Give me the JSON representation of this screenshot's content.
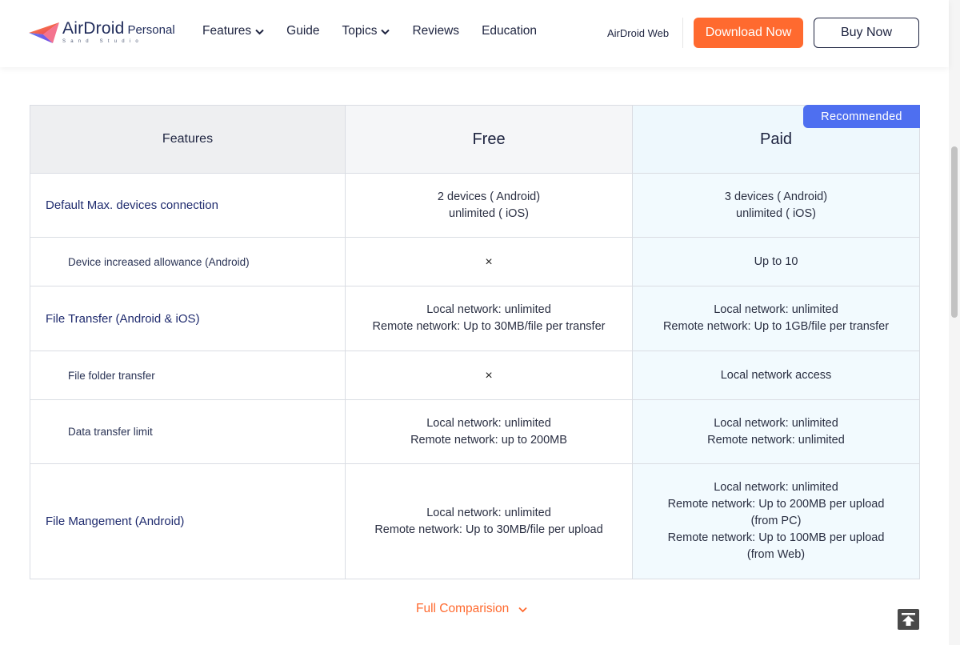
{
  "header": {
    "logo": {
      "brand": "AirDroid",
      "product": "Personal",
      "tagline": "Sand Studio"
    },
    "nav": [
      {
        "label": "Features",
        "has_dropdown": true
      },
      {
        "label": "Guide",
        "has_dropdown": false
      },
      {
        "label": "Topics",
        "has_dropdown": true
      },
      {
        "label": "Reviews",
        "has_dropdown": false
      },
      {
        "label": "Education",
        "has_dropdown": false
      }
    ],
    "airdroid_web_label": "AirDroid Web",
    "download_label": "Download Now",
    "buy_label": "Buy Now"
  },
  "colors": {
    "accent_orange": "#ff6a2f",
    "badge_blue": "#4e6ff0",
    "navy": "#1e2440"
  },
  "comparison": {
    "columns": {
      "features": "Features",
      "free": "Free",
      "paid": "Paid",
      "paid_badge": "Recommended"
    },
    "rows": [
      {
        "feature": "Default Max. devices connection",
        "sub": false,
        "free": [
          "2 devices ( Android)",
          "unlimited ( iOS)"
        ],
        "paid": [
          "3 devices ( Android)",
          "unlimited ( iOS)"
        ]
      },
      {
        "feature": "Device increased allowance (Android)",
        "sub": true,
        "free": [
          "×"
        ],
        "paid": [
          "Up to 10"
        ]
      },
      {
        "feature": "File Transfer (Android & iOS)",
        "sub": false,
        "free": [
          "Local network: unlimited",
          "Remote network: Up to 30MB/file per transfer"
        ],
        "paid": [
          "Local network: unlimited",
          "Remote network: Up to 1GB/file per transfer"
        ]
      },
      {
        "feature": "File folder transfer",
        "sub": true,
        "free": [
          "×"
        ],
        "paid": [
          "Local network access"
        ]
      },
      {
        "feature": "Data transfer limit",
        "sub": true,
        "free": [
          "Local network: unlimited",
          "Remote network: up to 200MB"
        ],
        "paid": [
          "Local network: unlimited",
          "Remote network: unlimited"
        ]
      },
      {
        "feature": "File Mangement (Android)",
        "sub": false,
        "free": [
          "Local network: unlimited",
          "Remote network: Up to 30MB/file per upload"
        ],
        "paid": [
          "Local network: unlimited",
          "Remote network: Up to 200MB per upload",
          "(from PC)",
          "Remote network: Up to 100MB per upload",
          "(from Web)"
        ]
      }
    ]
  },
  "full_comparison_label": "Full Comparision",
  "icons": {
    "back_to_top": "arrow-up-to-line-icon",
    "dropdown": "chevron-down-icon",
    "unavailable": "cross-icon"
  }
}
